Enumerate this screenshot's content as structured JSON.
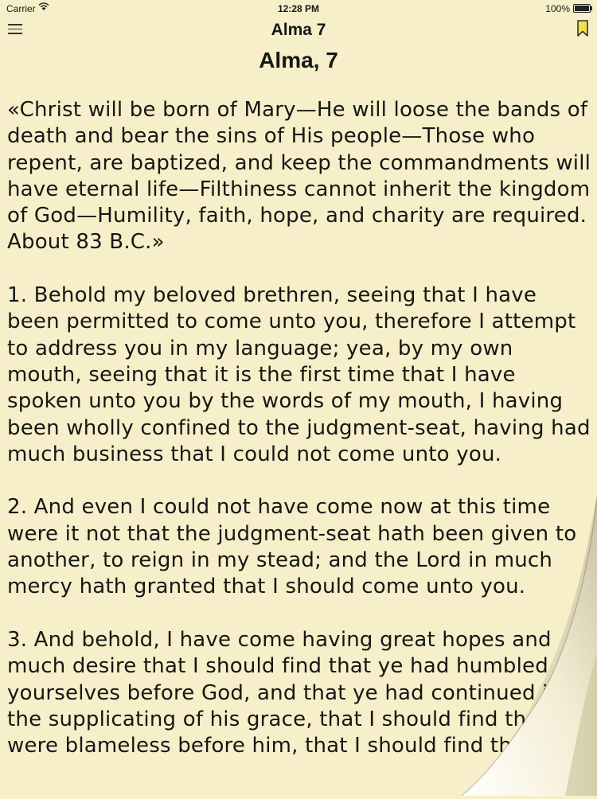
{
  "status_bar": {
    "carrier": "Carrier",
    "time": "12:28 PM",
    "battery": "100%"
  },
  "nav": {
    "title": "Alma 7",
    "menu_icon": "hamburger-menu-icon",
    "bookmark_icon": "bookmark-icon"
  },
  "chapter": {
    "heading": "Alma, 7",
    "summary": "«Christ will be born of Mary—He will loose the bands of death and bear the sins of His people—Those who repent, are baptized, and keep the commandments will have eternal life—Filthiness cannot inherit the kingdom of God—Humility, faith, hope, and charity are required. About 83 B.C.»",
    "verses": [
      "1. Behold my beloved brethren, seeing that I have been permitted to come unto you, therefore I attempt to address you in my language; yea, by my own mouth, seeing that it is the first time that I have spoken unto you by the words of my mouth, I having been wholly confined to the judgment-seat, having had much business that I could not come unto you.",
      "2. And even I could not have come now at this time were it not that the judgment-seat hath been given to another, to reign in my stead; and the Lord in much mercy hath granted that I should come unto you.",
      "3. And behold, I have come having great hopes and much desire that I should find that ye had humbled yourselves before God, and that ye had continued in the supplicating of his grace, that I should find that ye were blameless before him, that I should find that ye"
    ]
  },
  "colors": {
    "page_background": "#f7efc9",
    "text": "#161616",
    "bookmark_fill": "#f4e04a"
  }
}
